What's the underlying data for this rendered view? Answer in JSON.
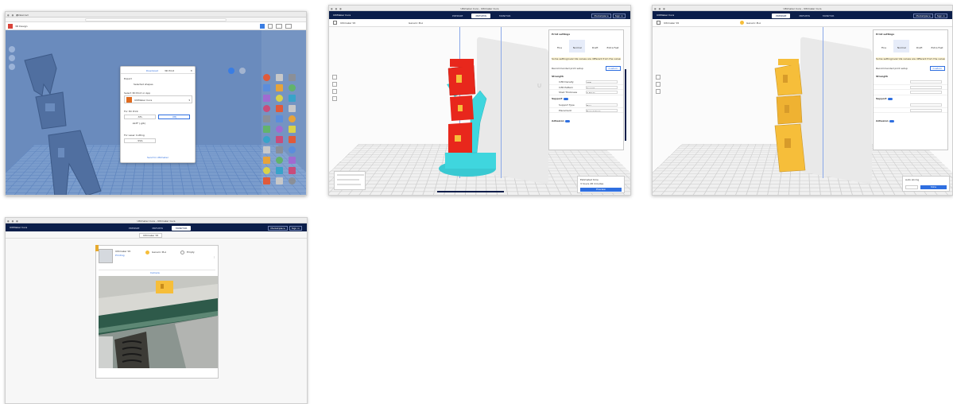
{
  "shots": {
    "tinkercad": {
      "tab": "Tinkercad",
      "project": "3D Design",
      "dialog_tabs": [
        "Download",
        "3D Print"
      ],
      "dialog_heading": "Export",
      "include_label": "Selected shapes",
      "app_prompt": "Select 3D Print or App",
      "app_name": "UltiMaker Cura",
      "for_label": "For 3D Print",
      "formats": [
        ".STL",
        ".OBJ"
      ],
      "format2_label": ".GLTF (.glb)",
      "for_label2": "For Laser Cutting",
      "svg_label": ".SVG",
      "footer": "Send to Ultimaker"
    },
    "cura_prepare_support": {
      "window_title": "Ultimaker Cura - Ultimaker Cura",
      "brand": "UltiMaker Cura",
      "stages": [
        "PREPARE",
        "PREVIEW",
        "MONITOR"
      ],
      "active_stage": 1,
      "top_actions": [
        "Marketplace",
        "Sign in"
      ],
      "printer_name": "Ultimaker S5",
      "material": "Generic PLA",
      "profile_header": "Print settings",
      "profile_tabs": [
        "Fine",
        "Normal",
        "Draft",
        "Extra Fast"
      ],
      "notice": "Some setting/override values are different from the values stored in the profile.",
      "recommended_label": "Recommended print setup",
      "custom_button": "Custom",
      "sections": [
        "Strength",
        "Support",
        "Adhesion"
      ],
      "settings_rows": [
        {
          "key": "Infill Density",
          "value": "20%"
        },
        {
          "key": "Infill Pattern",
          "value": "Gyroid"
        },
        {
          "key": "Shell Thickness",
          "value": "0.8mm"
        },
        {
          "key": "Support Type",
          "value": "Tree"
        },
        {
          "key": "Placement",
          "value": "Everywhere"
        }
      ],
      "slice_status": "Estimated time",
      "slice_time": "3 hours 28 minutes",
      "preview_button": "Preview"
    },
    "cura_prepare_plain": {
      "window_title": "Ultimaker Cura - Ultimaker Cura",
      "brand": "UltiMaker Cura",
      "stages": [
        "PREPARE",
        "PREVIEW",
        "MONITOR"
      ],
      "active_stage": 0,
      "top_actions": [
        "Marketplace",
        "Sign in"
      ],
      "printer_name": "Ultimaker S5",
      "material": "Generic PLA",
      "profile_header": "Print settings",
      "profile_tabs": [
        "Fine",
        "Normal",
        "Draft",
        "Extra Fast"
      ],
      "notice": "Some setting/override values are different from the values stored in the profile.",
      "recommended_label": "Recommended print setup",
      "custom_button": "Custom",
      "sections": [
        "Strength",
        "Support",
        "Adhesion"
      ],
      "slice_button": "Slice",
      "slice_status": "Auto slicing"
    },
    "cura_monitor": {
      "window_title": "Ultimaker Cura - Ultimaker Cura",
      "brand": "UltiMaker Cura",
      "stages": [
        "PREPARE",
        "PREVIEW",
        "MONITOR"
      ],
      "active_stage": 2,
      "top_actions": [
        "Marketplace",
        "Sign in"
      ],
      "printer_name": "Ultimaker S5",
      "printer_status": "Printing",
      "extruder1": "Generic PLA",
      "extruder2": "Empty",
      "camera_tab": "Camera"
    }
  },
  "colors": {
    "cura_navy": "#0b1e4a",
    "tinker_blue": "#5a7aaf",
    "support_cyan": "#3fd6de",
    "model_red": "#e8271c",
    "model_yellow": "#f6be3a",
    "cura_blue": "#2f6fe0"
  }
}
